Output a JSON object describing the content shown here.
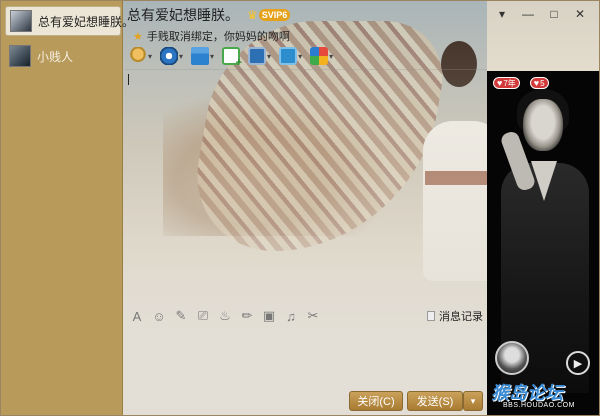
{
  "window": {
    "title": "总有爱妃想睡朕。",
    "vip_label": "SVIP6",
    "status_text": "手贱取消绑定，你妈妈的吻啊",
    "controls": [
      "▾",
      "—",
      "□",
      "✕"
    ]
  },
  "contacts": [
    {
      "name": "总有爱妃想睡朕。",
      "active": true
    },
    {
      "name": "小贱人",
      "active": false
    }
  ],
  "toolbar": {
    "items": [
      {
        "icon": "voice-call-icon"
      },
      {
        "icon": "video-call-icon"
      },
      {
        "icon": "send-file-icon"
      },
      {
        "icon": "create-discussion-icon"
      },
      {
        "icon": "remote-assist-icon"
      },
      {
        "icon": "screen-share-icon"
      },
      {
        "icon": "apps-icon"
      }
    ]
  },
  "input_toolbar": {
    "tools": [
      "A",
      "☺",
      "✎",
      "⎚",
      "♨",
      "✏",
      "▣",
      "♫",
      "✂"
    ],
    "history_label": "消息记录"
  },
  "buttons": {
    "close": "关闭(C)",
    "send": "发送(S)",
    "send_more": "▾"
  },
  "profile": {
    "badge_years": "7年",
    "badge_hearts": "5",
    "play_glyph": "▶"
  },
  "watermark": {
    "text": "猴岛论坛",
    "url": "BBS.HOUDAO.COM"
  }
}
